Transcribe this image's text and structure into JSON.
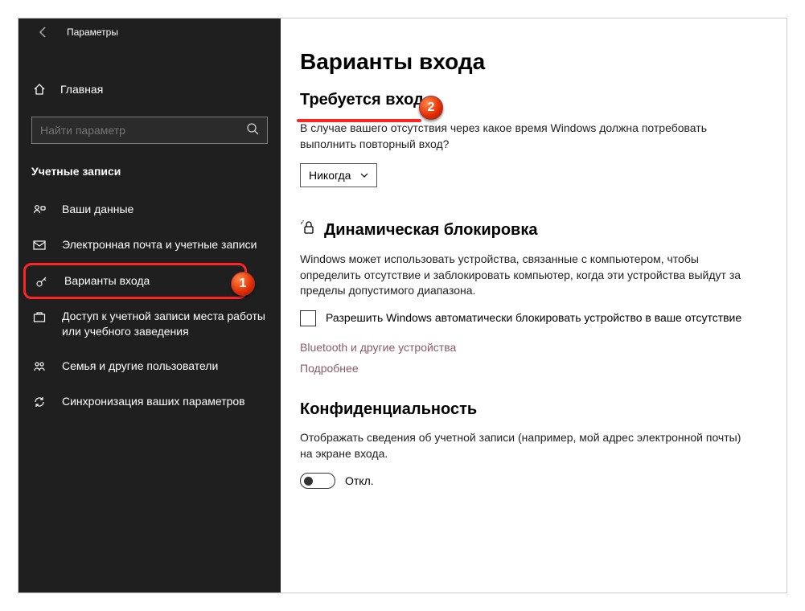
{
  "window": {
    "title": "Параметры"
  },
  "sidebar": {
    "home_label": "Главная",
    "search_placeholder": "Найти параметр",
    "category_title": "Учетные записи",
    "items": [
      {
        "label": "Ваши данные"
      },
      {
        "label": "Электронная почта и учетные записи"
      },
      {
        "label": "Варианты входа"
      },
      {
        "label": "Доступ к учетной записи места работы или учебного заведения"
      },
      {
        "label": "Семья и другие пользователи"
      },
      {
        "label": "Синхронизация ваших параметров"
      }
    ]
  },
  "content": {
    "page_title": "Варианты входа",
    "require_signin": {
      "heading": "Требуется вход",
      "question": "В случае вашего отсутствия через какое время Windows должна потребовать выполнить повторный вход?",
      "selected": "Никогда"
    },
    "dynamic_lock": {
      "heading": "Динамическая блокировка",
      "desc": "Windows может использовать устройства, связанные с компьютером, чтобы определить отсутствие и заблокировать компьютер, когда эти устройства выйдут за пределы допустимого диапазона.",
      "checkbox_label": "Разрешить Windows автоматически блокировать устройство в ваше отсутствие",
      "link_bluetooth": "Bluetooth и другие устройства",
      "link_more": "Подробнее"
    },
    "privacy": {
      "heading": "Конфиденциальность",
      "desc": "Отображать сведения об учетной записи (например, мой адрес электронной почты) на экране входа.",
      "toggle_label": "Откл."
    }
  },
  "annotations": {
    "marker1": "1",
    "marker2": "2"
  }
}
